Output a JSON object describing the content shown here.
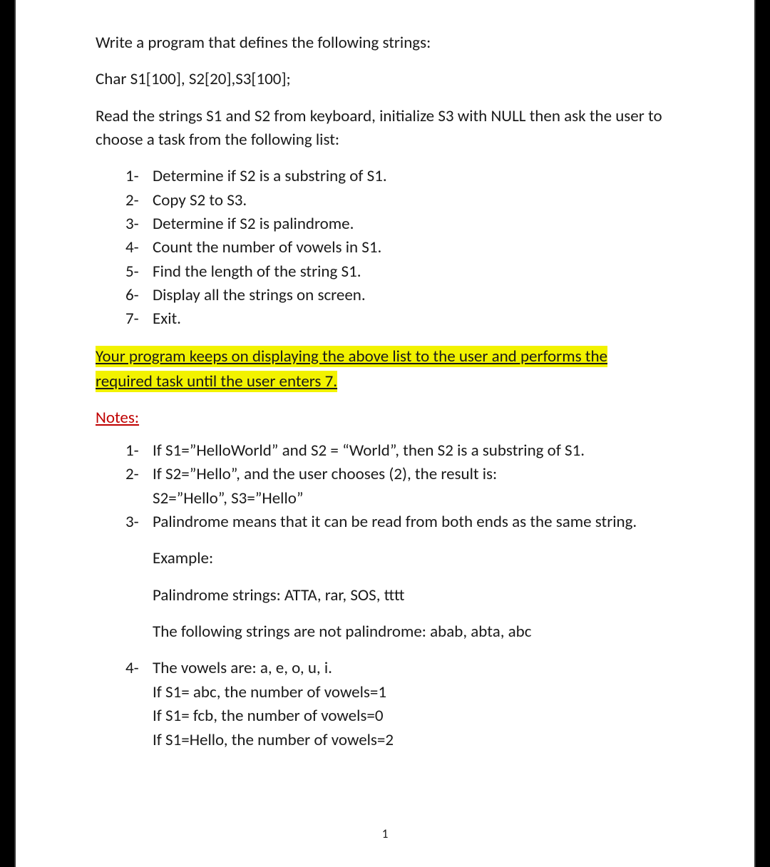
{
  "p1": "Write a program that defines the following strings:",
  "p2": "Char S1[100], S2[20],S3[100];",
  "p3": "Read the strings S1 and S2 from keyboard, initialize S3 with NULL then ask the user to choose a task from the following list:",
  "tasks": [
    {
      "n": "1-",
      "t": "Determine if S2 is a substring of S1."
    },
    {
      "n": "2-",
      "t": "Copy S2 to S3."
    },
    {
      "n": "3-",
      "t": "Determine if S2 is palindrome."
    },
    {
      "n": "4-",
      "t": "Count the number of vowels in S1."
    },
    {
      "n": "5-",
      "t": "Find the length of the string S1."
    },
    {
      "n": "6-",
      "t": "Display all the strings on screen."
    },
    {
      "n": "7-",
      "t": "Exit."
    }
  ],
  "highlight1": "Your program keeps on displaying the above list to the user and performs the",
  "highlight2": "required task until the user enters 7.",
  "notes_heading": "Notes:",
  "note1": {
    "n": "1-",
    "t": "If S1=”HelloWorld” and S2 = “World”, then S2 is a substring of S1."
  },
  "note2": {
    "n": "2-",
    "t": "If S2=”Hello”, and the user chooses (2), the result is:"
  },
  "note2b": "S2=”Hello”, S3=”Hello”",
  "note3": {
    "n": "3-",
    "t": "Palindrome means that it can be read from both ends as the same string."
  },
  "note3_ex": "Example:",
  "note3_pal": "Palindrome strings: ATTA, rar, SOS, tttt",
  "note3_npal": "The following strings are not palindrome: abab, abta, abc",
  "note4": {
    "n": "4-",
    "t": "The vowels are: a, e, o, u, i."
  },
  "note4a": "If S1= abc, the number of vowels=1",
  "note4b": "If S1= fcb, the number of vowels=0",
  "note4c": "If S1=Hello, the number of vowels=2",
  "page_number": "1"
}
